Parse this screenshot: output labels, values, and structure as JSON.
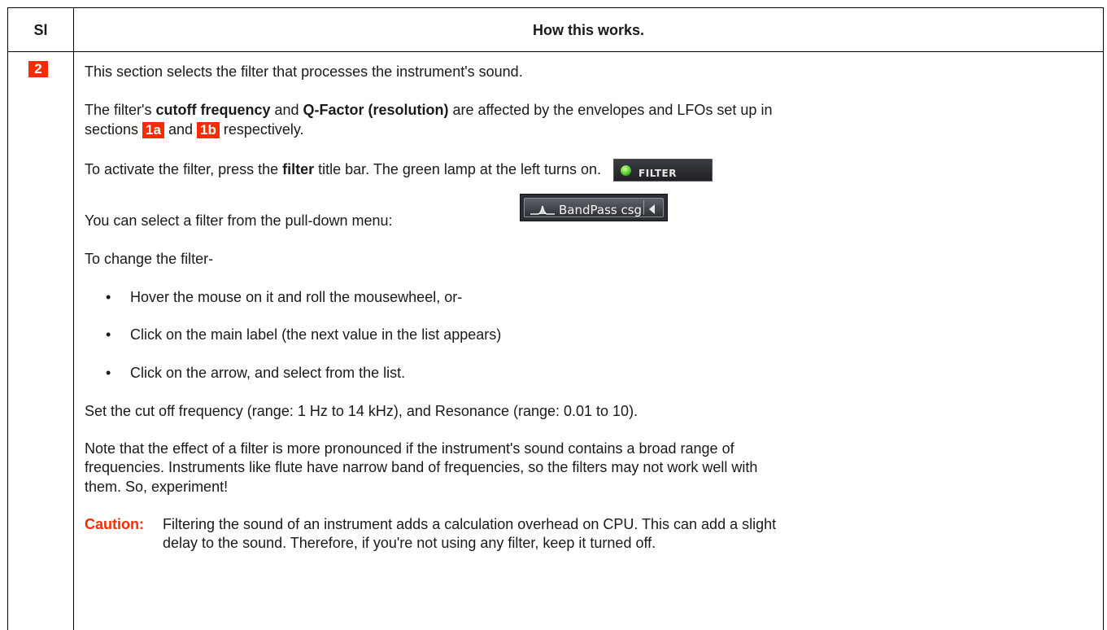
{
  "header": {
    "si": "Sl",
    "how": "How this works."
  },
  "row": {
    "section_tag": "2",
    "p1": "This section selects the filter that processes the instrument's sound.",
    "p2": {
      "a": "The filter's ",
      "b1": "cutoff frequency",
      "c": " and ",
      "b2": "Q-Factor (resolution)",
      "d": " are affected by the envelopes and LFOs set up in",
      "e": "sections ",
      "tag1": "1a",
      "f": " and ",
      "tag2": "1b",
      "g": " respectively."
    },
    "p3": {
      "a": "To activate the filter, press the ",
      "b": "filter",
      "c": " title bar. The green lamp at the left turns on.",
      "widget_label": "FILTER",
      "lamp_color": "#4dcc2a"
    },
    "p4": {
      "a": "You can select a filter from the pull-down menu:",
      "widget_label": "BandPass csg"
    },
    "p5": "To change the filter-",
    "bullets": [
      "Hover the mouse on it and roll the mousewheel, or-",
      "Click on the main label (the next value in the list appears)",
      "Click on the arrow, and select from the list."
    ],
    "bullet_glyph": "•",
    "p6": "Set the cut off frequency (range: 1 Hz to 14 kHz), and Resonance (range: 0.01 to 10).",
    "p7": {
      "l1": "Note that the effect of a filter is more pronounced if the instrument's sound contains a broad range of",
      "l2": "frequencies. Instruments like flute have narrow band of frequencies, so the filters may not work well with",
      "l3": "them. So, experiment!"
    },
    "caution": {
      "label": "Caution:",
      "l1": "Filtering the sound of an instrument adds a calculation overhead on CPU. This can add a slight",
      "l2": "delay to the sound. Therefore, if you're not using any filter, keep it turned off."
    }
  },
  "colors": {
    "accent": "#ff2a00",
    "border": "#000000"
  },
  "icons": {
    "lamp": "green-lamp-icon",
    "bandpass": "bandpass-curve-icon",
    "arrow": "arrow-left-icon"
  }
}
